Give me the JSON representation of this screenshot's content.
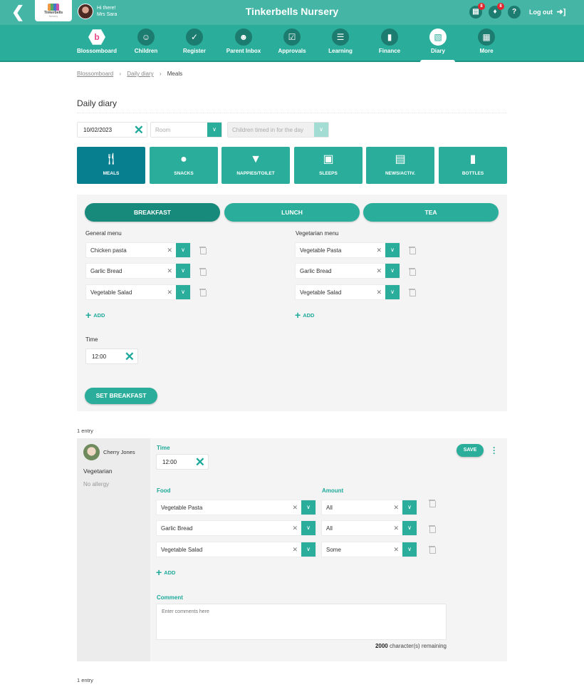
{
  "header": {
    "title": "Tinkerbells Nursery",
    "logo_text": "Tinkerbells",
    "logo_subtext": "Nursery",
    "greeting": "Hi there!",
    "user_name": "Mrs Sara",
    "messages_badge": "8",
    "notifications_badge": "8",
    "help_label": "?",
    "logout_label": "Log out"
  },
  "nav": {
    "items": [
      {
        "label": "Blossomboard",
        "icon": "blossom-logo-icon"
      },
      {
        "label": "Children",
        "icon": "smiley-icon"
      },
      {
        "label": "Register",
        "icon": "calendar-check-icon"
      },
      {
        "label": "Parent Inbox",
        "icon": "parent-icon"
      },
      {
        "label": "Approvals",
        "icon": "clipboard-check-icon"
      },
      {
        "label": "Learning",
        "icon": "book-icon"
      },
      {
        "label": "Finance",
        "icon": "bar-chart-icon"
      },
      {
        "label": "Diary",
        "icon": "diary-icon"
      },
      {
        "label": "More",
        "icon": "grid-icon"
      }
    ],
    "active": "Diary"
  },
  "breadcrumb": {
    "items": [
      "Blossomboard",
      "Daily diary",
      "Meals"
    ]
  },
  "page": {
    "title": "Daily diary"
  },
  "filters": {
    "date": "10/02/2023",
    "room_placeholder": "Room",
    "children_placeholder": "Children timed in for the day"
  },
  "categories": {
    "items": [
      {
        "label": "MEALS",
        "icon": "cutlery-icon"
      },
      {
        "label": "SNACKS",
        "icon": "apple-icon"
      },
      {
        "label": "NAPPIES/TOILET",
        "icon": "nappy-icon"
      },
      {
        "label": "SLEEPS",
        "icon": "bed-icon"
      },
      {
        "label": "NEWS/ACTIV.",
        "icon": "book-open-icon"
      },
      {
        "label": "BOTTLES",
        "icon": "bottle-icon"
      }
    ],
    "active": "MEALS"
  },
  "meal_setup": {
    "tabs": [
      "BREAKFAST",
      "LUNCH",
      "TEA"
    ],
    "active_tab": "BREAKFAST",
    "general_menu_label": "General menu",
    "general_menu": [
      "Chicken pasta",
      "Garlic Bread",
      "Vegetable Salad"
    ],
    "vegetarian_menu_label": "Vegetarian menu",
    "vegetarian_menu": [
      "Vegetable Pasta",
      "Garlic Bread",
      "Vegetable Salad"
    ],
    "add_label": "ADD",
    "time_label": "Time",
    "time_value": "12:00",
    "set_button": "SET BREAKFAST"
  },
  "entries": {
    "count_label": "1 entry",
    "items": [
      {
        "child_name": "Cherry Jones",
        "diet": "Vegetarian",
        "allergy": "No allergy",
        "time_label": "Time",
        "time_value": "12:00",
        "food_label": "Food",
        "amount_label": "Amount",
        "rows": [
          {
            "food": "Vegetable Pasta",
            "amount": "All"
          },
          {
            "food": "Garlic Bread",
            "amount": "All"
          },
          {
            "food": "Vegetable Salad",
            "amount": "Some"
          }
        ],
        "add_label": "ADD",
        "comment_label": "Comment",
        "comment_placeholder": "Enter comments here",
        "remaining_count": "2000",
        "remaining_text": "character(s) remaining",
        "save_label": "SAVE"
      }
    ]
  },
  "footer": {
    "count_label": "1 entry"
  }
}
